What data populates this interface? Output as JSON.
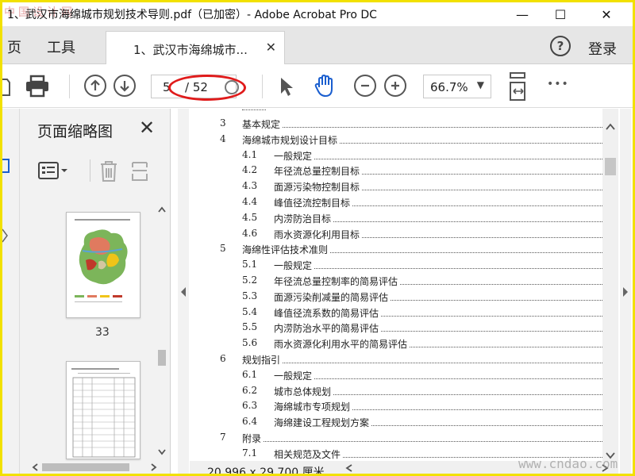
{
  "window": {
    "title": "1、武汉市海绵城市规划技术导则.pdf（已加密）- Adobe Acrobat Pro DC",
    "watermark_top": "中国设计网",
    "watermark_bottom": "www.cndao.com",
    "minimize": "—",
    "maximize": "☐",
    "close": "✕"
  },
  "nav": {
    "home": "页",
    "tools": "工具",
    "document_tab": "1、武汉市海绵城市...",
    "tab_close": "✕",
    "help": "?",
    "login": "登录"
  },
  "toolbar": {
    "current_page": "5",
    "total_pages": "/ 52",
    "zoom": "66.7%",
    "zoom_arrow": "▼",
    "more": "•••"
  },
  "thumbnails": {
    "title": "页面缩略图",
    "close": "✕",
    "page_label": "33"
  },
  "toc": [
    {
      "num": "3",
      "text": "基本规定",
      "level": 1
    },
    {
      "num": "4",
      "text": "海绵城市规划设计目标",
      "level": 1
    },
    {
      "num": "4.1",
      "text": "一般规定",
      "level": 2
    },
    {
      "num": "4.2",
      "text": "年径流总量控制目标",
      "level": 2
    },
    {
      "num": "4.3",
      "text": "面源污染物控制目标",
      "level": 2
    },
    {
      "num": "4.4",
      "text": "峰值径流控制目标",
      "level": 2
    },
    {
      "num": "4.5",
      "text": "内涝防治目标",
      "level": 2
    },
    {
      "num": "4.6",
      "text": "雨水资源化利用目标",
      "level": 2
    },
    {
      "num": "5",
      "text": "海绵性评估技术准则",
      "level": 1
    },
    {
      "num": "5.1",
      "text": "一般规定",
      "level": 2
    },
    {
      "num": "5.2",
      "text": "年径流总量控制率的简易评估",
      "level": 2
    },
    {
      "num": "5.3",
      "text": "面源污染削减量的简易评估",
      "level": 2
    },
    {
      "num": "5.4",
      "text": "峰值径流系数的简易评估",
      "level": 2
    },
    {
      "num": "5.5",
      "text": "内涝防治水平的简易评估",
      "level": 2
    },
    {
      "num": "5.6",
      "text": "雨水资源化利用水平的简易评估",
      "level": 2
    },
    {
      "num": "6",
      "text": "规划指引",
      "level": 1
    },
    {
      "num": "6.1",
      "text": "一般规定",
      "level": 2
    },
    {
      "num": "6.2",
      "text": "城市总体规划",
      "level": 2
    },
    {
      "num": "6.3",
      "text": "海绵城市专项规划",
      "level": 2
    },
    {
      "num": "6.4",
      "text": "海绵建设工程规划方案",
      "level": 2
    },
    {
      "num": "7",
      "text": "附录",
      "level": 1
    },
    {
      "num": "7.1",
      "text": "相关规范及文件",
      "level": 2
    }
  ],
  "status": {
    "page_size": "20.996 x 29.700 厘米"
  },
  "colors": {
    "frame": "#f2e100",
    "annotation_oval": "#e01b1b",
    "tabbar_bg": "#e6e6e6",
    "panel_bg": "#f2f2f2"
  }
}
